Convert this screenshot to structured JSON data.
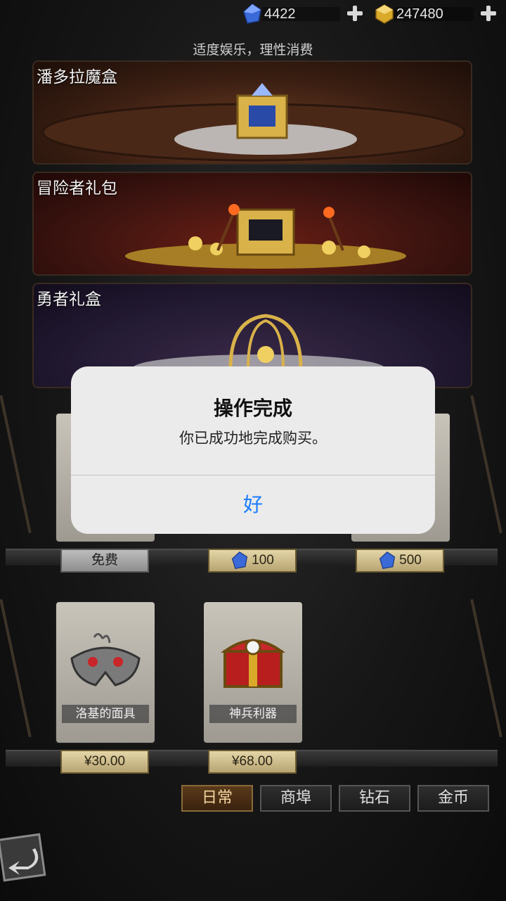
{
  "currency": {
    "gems": "4422",
    "gold": "247480"
  },
  "notice": "适度娱乐，理性消费",
  "banners": [
    {
      "title": "潘多拉魔盒"
    },
    {
      "title": "冒险者礼包"
    },
    {
      "title": "勇者礼盒"
    }
  ],
  "row1_prices": [
    {
      "label": "免费"
    },
    {
      "label": "100"
    },
    {
      "label": "500"
    }
  ],
  "row2_items": [
    {
      "name": "洛基的面具",
      "price": "¥30.00"
    },
    {
      "name": "神兵利器",
      "price": "¥68.00"
    }
  ],
  "tabs": [
    {
      "label": "日常",
      "active": true
    },
    {
      "label": "商埠"
    },
    {
      "label": "钻石"
    },
    {
      "label": "金币"
    }
  ],
  "dialog": {
    "title": "操作完成",
    "message": "你已成功地完成购买。",
    "ok": "好"
  },
  "colors": {
    "accent": "#1a7cff",
    "gem": "#3a6ad8",
    "gold": "#d9a92a"
  }
}
